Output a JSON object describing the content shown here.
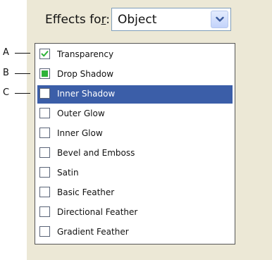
{
  "effects_for": {
    "label_before": "Effects fo",
    "label_mnemonic": "r",
    "label_after": ":",
    "selected": "Object"
  },
  "callouts": [
    "A",
    "B",
    "C"
  ],
  "effects": [
    {
      "label": "Transparency",
      "state": "checked",
      "selected": false
    },
    {
      "label": "Drop Shadow",
      "state": "partial",
      "selected": false
    },
    {
      "label": "Inner Shadow",
      "state": "unchecked",
      "selected": true
    },
    {
      "label": "Outer Glow",
      "state": "unchecked",
      "selected": false
    },
    {
      "label": "Inner Glow",
      "state": "unchecked",
      "selected": false
    },
    {
      "label": "Bevel and Emboss",
      "state": "unchecked",
      "selected": false
    },
    {
      "label": "Satin",
      "state": "unchecked",
      "selected": false
    },
    {
      "label": "Basic Feather",
      "state": "unchecked",
      "selected": false
    },
    {
      "label": "Directional Feather",
      "state": "unchecked",
      "selected": false
    },
    {
      "label": "Gradient Feather",
      "state": "unchecked",
      "selected": false
    }
  ],
  "colors": {
    "panel": "#ece8d6",
    "selection": "#3b5ea8",
    "check": "#2fb33a"
  }
}
